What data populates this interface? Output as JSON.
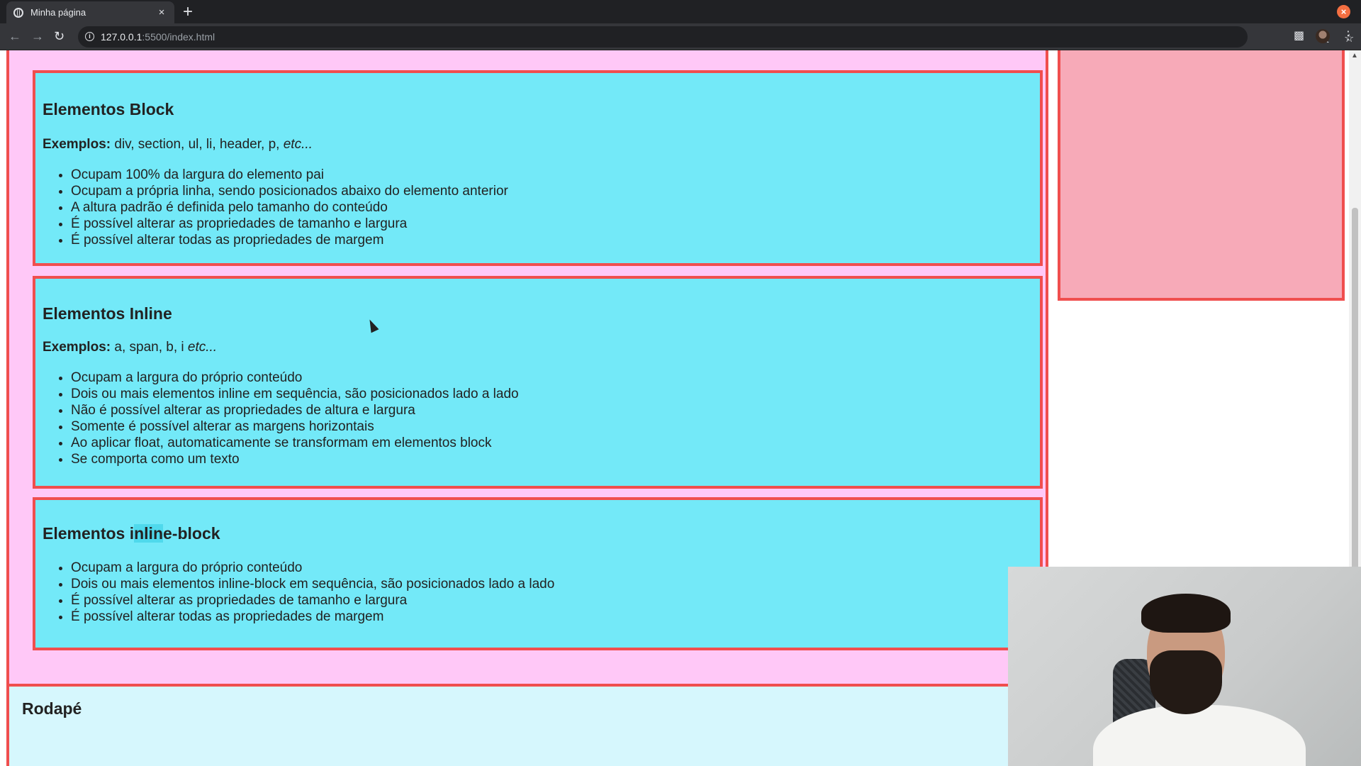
{
  "browser": {
    "tab_title": "Minha página",
    "tab_close": "×",
    "new_tab": "+",
    "url_host": "127.0.0.1",
    "url_path": ":5500/index.html",
    "close_glyph": "×"
  },
  "sections": [
    {
      "title": "Elementos Block",
      "examples_label": "Exemplos:",
      "examples_text": " div, section, ul, li, header, p, ",
      "examples_etc": "etc...",
      "items": [
        "Ocupam 100% da largura do elemento pai",
        "Ocupam a própria linha, sendo posicionados abaixo do elemento anterior",
        "A altura padrão é definida pelo tamanho do conteúdo",
        "É possível alterar as propriedades de tamanho e largura",
        "É possível alterar todas as propriedades de margem"
      ]
    },
    {
      "title": "Elementos Inline",
      "examples_label": "Exemplos:",
      "examples_text": " a, span, b, i ",
      "examples_etc": "etc...",
      "items": [
        "Ocupam a largura do próprio conteúdo",
        "Dois ou mais elementos inline em sequência, são posicionados lado a lado",
        "Não é possível alterar as propriedades de altura e largura",
        "Somente é possível alterar as margens horizontais",
        "Ao aplicar float, automaticamente se transformam em elementos block",
        "Se comporta como um texto"
      ]
    },
    {
      "title_before": "Elementos i",
      "title_highlight": "nlin",
      "title_after": "e-block",
      "items": [
        "Ocupam a largura do próprio conteúdo",
        "Dois ou mais elementos inline-block em sequência, são posicionados lado a lado",
        "É possível alterar as propriedades de tamanho e largura",
        "É possível alterar todas as propriedades de margem"
      ]
    }
  ],
  "footer": {
    "title": "Rodapé"
  },
  "colors": {
    "main_bg": "#ffc8f7",
    "section_bg": "#73e9f8",
    "border": "#f04e4e",
    "sidebar_bg": "#f7aab8",
    "footer_bg": "#d6f7fd"
  },
  "icons": {
    "back": "back-arrow-icon",
    "forward": "forward-arrow-icon",
    "reload": "reload-icon",
    "info": "site-info-icon",
    "translate": "translate-icon",
    "star": "bookmark-star-icon",
    "extensions": "puzzle-icon",
    "menu": "kebab-menu-icon"
  }
}
